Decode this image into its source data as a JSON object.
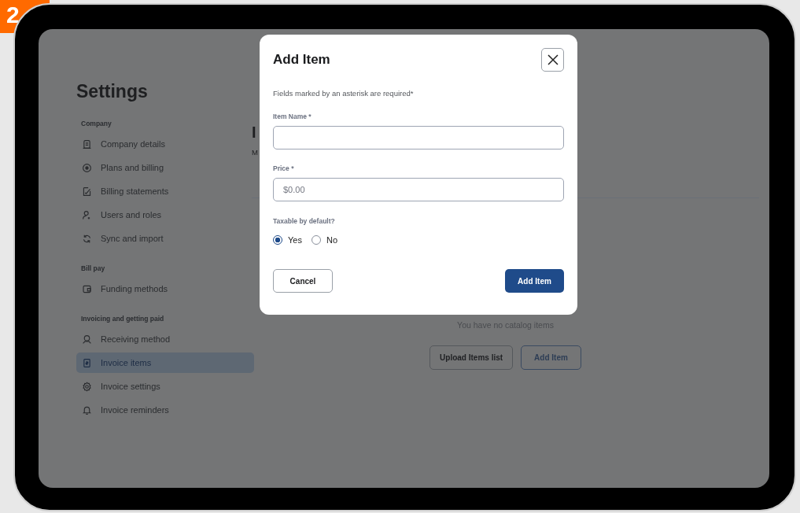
{
  "step_badge": "2",
  "sidebar": {
    "title": "Settings",
    "sections": [
      {
        "label": "Company",
        "items": [
          {
            "label": "Company details",
            "selected": false
          },
          {
            "label": "Plans and billing",
            "selected": false
          },
          {
            "label": "Billing statements",
            "selected": false
          },
          {
            "label": "Users and roles",
            "selected": false
          },
          {
            "label": "Sync and import",
            "selected": false
          }
        ]
      },
      {
        "label": "Bill pay",
        "items": [
          {
            "label": "Funding methods",
            "selected": false
          }
        ]
      },
      {
        "label": "Invoicing and getting paid",
        "items": [
          {
            "label": "Receiving method",
            "selected": false
          },
          {
            "label": "Invoice items",
            "selected": true
          },
          {
            "label": "Invoice settings",
            "selected": false
          },
          {
            "label": "Invoice reminders",
            "selected": false
          }
        ]
      }
    ]
  },
  "main": {
    "heading": "I",
    "subtitle": "M",
    "empty_message": "You have no catalog items",
    "buttons": [
      {
        "label": "Upload Items list",
        "kind": "secondary"
      },
      {
        "label": "Add Item",
        "kind": "outline"
      }
    ]
  },
  "modal": {
    "title": "Add Item",
    "note": "Fields marked by an asterisk are required*",
    "fields": [
      {
        "label": "Item Name *"
      },
      {
        "label": "Price *",
        "placeholder": "$0.00"
      }
    ],
    "radio_group": {
      "label": "Taxable by default?",
      "options": [
        {
          "label": "Yes",
          "selected": true
        },
        {
          "label": "No",
          "selected": false
        }
      ]
    },
    "buttons": [
      {
        "label": "Cancel",
        "kind": "secondary"
      },
      {
        "label": "Add Item",
        "kind": "primary"
      }
    ]
  }
}
